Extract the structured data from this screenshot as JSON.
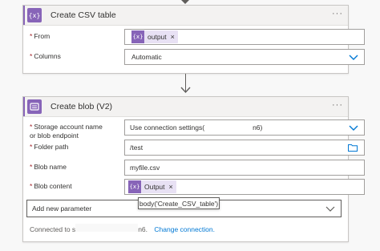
{
  "card1": {
    "title": "Create CSV table",
    "icon_text": "{x}",
    "more_icon": "···",
    "from_label": "From",
    "from_token": "output",
    "from_token_icon": "{x}",
    "columns_label": "Columns",
    "columns_value": "Automatic"
  },
  "card2": {
    "title": "Create blob (V2)",
    "more_icon": "···",
    "storage_label_1": "Storage account name",
    "storage_label_2": "or blob endpoint",
    "storage_value_prefix": "Use connection settings(",
    "storage_value_suffix": "n6)",
    "folder_label": "Folder path",
    "folder_value": "/test",
    "blob_name_label": "Blob name",
    "blob_name_value": "myfile.csv",
    "blob_content_label": "Blob content",
    "blob_content_token": "Output",
    "blob_content_token_icon": "{x}",
    "tooltip": "body('Create_CSV_table')",
    "add_param": "Add new parameter",
    "connected_prefix": "Connected to s",
    "connected_suffix": "n6.",
    "change_connection": "Change connection."
  },
  "required_marker": "*",
  "close_glyph": "×",
  "colors": {
    "accent": "#8764b8",
    "token_bg": "#e8e1f4",
    "link": "#0078d4",
    "required": "#a4262c"
  }
}
